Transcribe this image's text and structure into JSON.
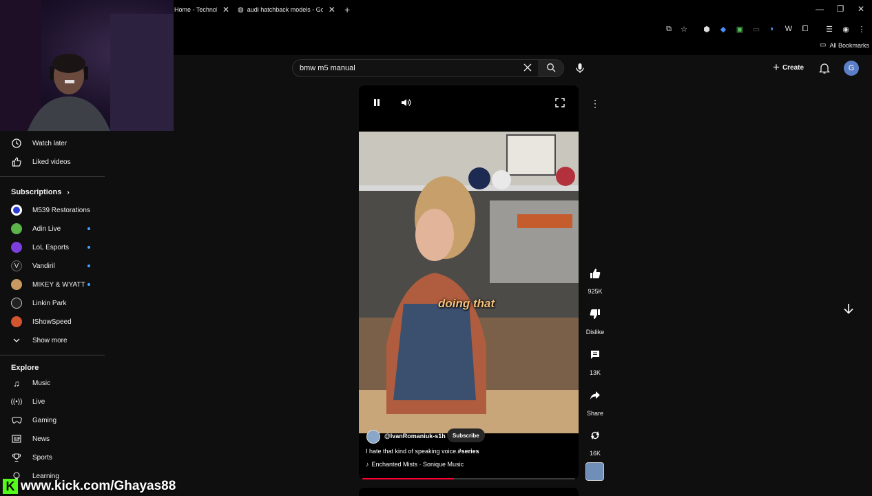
{
  "browser": {
    "tabs": [
      {
        "title": "Home - Technolo"
      },
      {
        "title": "audi hatchback models - Googl"
      }
    ],
    "bookmarks_label": "All Bookmarks"
  },
  "search": {
    "value": "bmw m5 manual"
  },
  "header": {
    "create_label": "Create",
    "avatar_letter": "G"
  },
  "sidebar": {
    "you_items": [
      {
        "label": "Watch later",
        "icon": "clock-icon"
      },
      {
        "label": "Liked videos",
        "icon": "thumb-up-icon"
      }
    ],
    "subscriptions_heading": "Subscriptions",
    "subscriptions": [
      {
        "label": "M539 Restorations",
        "color": "#2b3bd6",
        "dot": false
      },
      {
        "label": "Adin Live",
        "color": "#5bb34a",
        "dot": true
      },
      {
        "label": "LoL Esports",
        "color": "#7b3fe0",
        "dot": true
      },
      {
        "label": "Vandiril",
        "color": "#1a1a1a",
        "dot": true
      },
      {
        "label": "MIKEY & WYATT",
        "color": "#c89a62",
        "dot": true
      },
      {
        "label": "Linkin Park",
        "color": "#222222",
        "dot": false
      },
      {
        "label": "IShowSpeed",
        "color": "#d2552f",
        "dot": false
      }
    ],
    "show_more_label": "Show more",
    "explore_heading": "Explore",
    "explore": [
      {
        "label": "Music",
        "icon": "music-note-icon"
      },
      {
        "label": "Live",
        "icon": "live-icon"
      },
      {
        "label": "Gaming",
        "icon": "gaming-icon"
      },
      {
        "label": "News",
        "icon": "news-icon"
      },
      {
        "label": "Sports",
        "icon": "trophy-icon"
      },
      {
        "label": "Learning",
        "icon": "learning-icon"
      }
    ]
  },
  "short": {
    "caption_overlay": "doing that",
    "channel": "@IvanRomaniuk-s1h",
    "subscribe_label": "Subscribe",
    "description_text": "I hate that kind of speaking voice.",
    "description_tag": "#series",
    "music": "Enchanted Mists · Sonique Music",
    "progress_fraction": 0.43,
    "likes": "925K",
    "dislike_label": "Dislike",
    "comments": "13K",
    "share_label": "Share",
    "remix_count": "16K"
  },
  "stream_overlay": {
    "url_text": "www.kick.com/Ghayas88",
    "kick_letter": "K",
    "brand_color": "#53fc18"
  }
}
